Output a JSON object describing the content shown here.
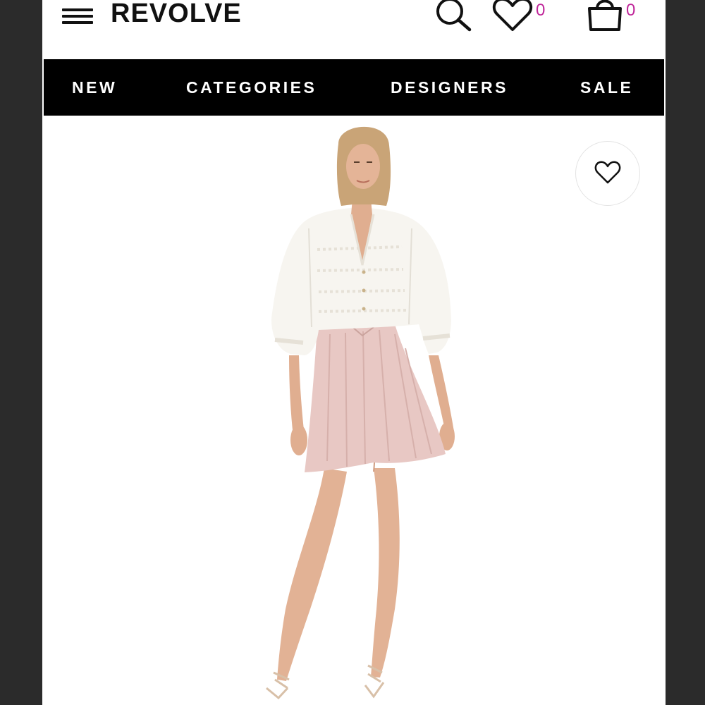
{
  "header": {
    "brand": "REVOLVE",
    "wishlist_count": "0",
    "cart_count": "0",
    "icons": {
      "menu": "hamburger-menu-icon",
      "search": "search-icon",
      "wishlist": "heart-icon",
      "cart": "shopping-bag-icon"
    },
    "accent_color": "#c0279a"
  },
  "nav": {
    "items": [
      {
        "label": "NEW"
      },
      {
        "label": "CATEGORIES"
      },
      {
        "label": "DESIGNERS"
      },
      {
        "label": "SALE"
      }
    ]
  },
  "product": {
    "favorite_icon": "heart-outline-icon",
    "colors": {
      "top": "#f7f5f0",
      "skirt": "#e8c8c4",
      "skin": "#e4b497",
      "hair": "#c9a477"
    }
  }
}
